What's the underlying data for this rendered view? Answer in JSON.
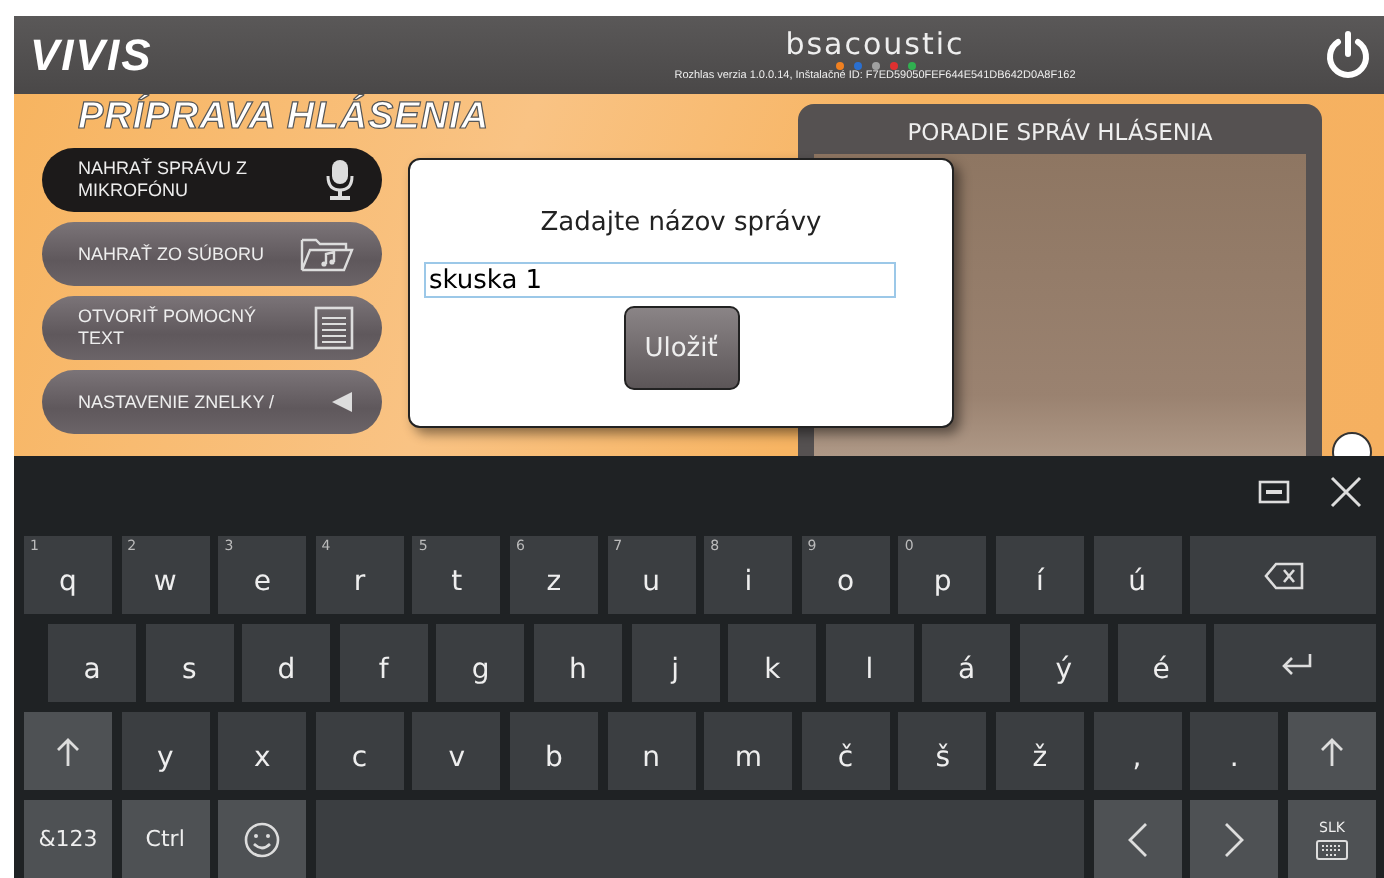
{
  "header": {
    "logo": "VIVIS",
    "brand": "bsacoustic",
    "brand_dots": [
      {
        "color": "#f08020"
      },
      {
        "color": "#2a6fd0"
      },
      {
        "color": "#a0a0a0"
      },
      {
        "color": "#e03030"
      },
      {
        "color": "#30b050"
      }
    ],
    "version": "Rozhlas verzia 1.0.0.14, Inštalačné ID: F7ED59050FEF644E541DB642D0A8F162"
  },
  "section_title": "PRÍPRAVA HLÁSENIA",
  "actions": [
    {
      "label": "NAHRAŤ SPRÁVU Z MIKROFÓNU",
      "kind": "mic",
      "selected": true
    },
    {
      "label": "NAHRAŤ ZO SÚBORU",
      "kind": "folder",
      "selected": false
    },
    {
      "label": "OTVORIŤ POMOCNÝ TEXT",
      "kind": "document",
      "selected": false
    },
    {
      "label": "NASTAVENIE ZNELKY /",
      "kind": "triangle",
      "selected": false
    }
  ],
  "order_panel": {
    "title": "PORADIE SPRÁV HLÁSENIA"
  },
  "dialog": {
    "title": "Zadajte názov správy",
    "value": "skuska 1",
    "button": "Uložiť"
  },
  "keyboard": {
    "rows": [
      [
        {
          "kind": "key",
          "label": "q",
          "hint": "1"
        },
        {
          "kind": "key",
          "label": "w",
          "hint": "2"
        },
        {
          "kind": "key",
          "label": "e",
          "hint": "3"
        },
        {
          "kind": "key",
          "label": "r",
          "hint": "4"
        },
        {
          "kind": "key",
          "label": "t",
          "hint": "5"
        },
        {
          "kind": "key",
          "label": "z",
          "hint": "6"
        },
        {
          "kind": "key",
          "label": "u",
          "hint": "7"
        },
        {
          "kind": "key",
          "label": "i",
          "hint": "8"
        },
        {
          "kind": "key",
          "label": "o",
          "hint": "9"
        },
        {
          "kind": "key",
          "label": "p",
          "hint": "0"
        },
        {
          "kind": "key",
          "label": "í"
        },
        {
          "kind": "key",
          "label": "ú"
        },
        {
          "kind": "backspace"
        }
      ],
      [
        {
          "kind": "key",
          "label": "a"
        },
        {
          "kind": "key",
          "label": "s"
        },
        {
          "kind": "key",
          "label": "d"
        },
        {
          "kind": "key",
          "label": "f"
        },
        {
          "kind": "key",
          "label": "g"
        },
        {
          "kind": "key",
          "label": "h"
        },
        {
          "kind": "key",
          "label": "j"
        },
        {
          "kind": "key",
          "label": "k"
        },
        {
          "kind": "key",
          "label": "l"
        },
        {
          "kind": "key",
          "label": "á"
        },
        {
          "kind": "key",
          "label": "ý"
        },
        {
          "kind": "key",
          "label": "é"
        },
        {
          "kind": "enter"
        }
      ],
      [
        {
          "kind": "shift"
        },
        {
          "kind": "key",
          "label": "y"
        },
        {
          "kind": "key",
          "label": "x"
        },
        {
          "kind": "key",
          "label": "c"
        },
        {
          "kind": "key",
          "label": "v"
        },
        {
          "kind": "key",
          "label": "b"
        },
        {
          "kind": "key",
          "label": "n"
        },
        {
          "kind": "key",
          "label": "m"
        },
        {
          "kind": "key",
          "label": "č"
        },
        {
          "kind": "key",
          "label": "š"
        },
        {
          "kind": "key",
          "label": "ž"
        },
        {
          "kind": "key",
          "label": ","
        },
        {
          "kind": "key",
          "label": "."
        },
        {
          "kind": "shift"
        }
      ],
      [
        {
          "kind": "function",
          "label": "&123"
        },
        {
          "kind": "function",
          "label": "Ctrl"
        },
        {
          "kind": "emoji"
        },
        {
          "kind": "space"
        },
        {
          "kind": "left"
        },
        {
          "kind": "right"
        },
        {
          "kind": "layout",
          "label": "SLK"
        }
      ]
    ]
  }
}
